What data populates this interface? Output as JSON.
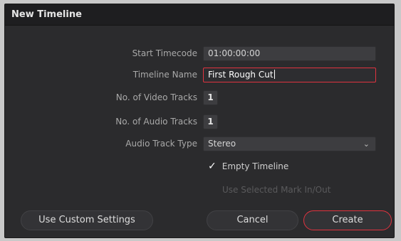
{
  "dialog": {
    "title": "New Timeline"
  },
  "form": {
    "start_timecode": {
      "label": "Start Timecode",
      "value": "01:00:00:00"
    },
    "timeline_name": {
      "label": "Timeline Name",
      "value": "First Rough Cut"
    },
    "video_tracks": {
      "label": "No. of Video Tracks",
      "value": "1"
    },
    "audio_tracks": {
      "label": "No. of Audio Tracks",
      "value": "1"
    },
    "audio_track_type": {
      "label": "Audio Track Type",
      "value": "Stereo"
    },
    "empty_timeline": {
      "label": "Empty Timeline",
      "checked": true
    },
    "use_selected_marks": {
      "label": "Use Selected Mark In/Out",
      "checked": false,
      "enabled": false
    }
  },
  "buttons": {
    "custom_settings": "Use Custom Settings",
    "cancel": "Cancel",
    "create": "Create"
  },
  "colors": {
    "accent": "#e0333f"
  }
}
